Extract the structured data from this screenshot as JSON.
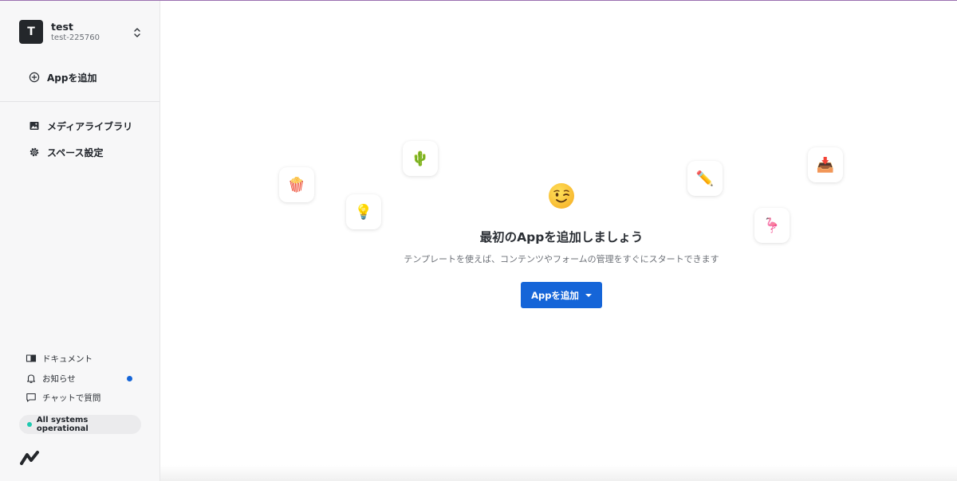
{
  "sidebar": {
    "space": {
      "avatar_letter": "T",
      "name": "test",
      "id": "test-225760"
    },
    "add_app_label": "Appを追加",
    "nav": [
      {
        "label": "メディアライブラリ",
        "icon": "image-icon"
      },
      {
        "label": "スペース設定",
        "icon": "gear-icon"
      }
    ],
    "utilities": [
      {
        "label": "ドキュメント",
        "icon": "book-icon"
      },
      {
        "label": "お知らせ",
        "icon": "bell-icon"
      },
      {
        "label": "チャットで質問",
        "icon": "chat-icon"
      }
    ],
    "status": {
      "label": "All systems operational",
      "color": "#1ec9b0"
    },
    "notify_dot_color": "#1565d8"
  },
  "main": {
    "heading": "最初のAppを追加しましょう",
    "subtext": "テンプレートを使えば、コンテンツやフォームの管理をすぐにスタートできます",
    "add_button_label": "Appを追加",
    "emojis": [
      {
        "name": "popcorn-icon",
        "glyph": "🍿"
      },
      {
        "name": "lightbulb-icon",
        "glyph": "💡"
      },
      {
        "name": "cactus-icon",
        "glyph": "🌵"
      },
      {
        "name": "pencil-icon",
        "glyph": "✏️"
      },
      {
        "name": "flamingo-icon",
        "glyph": "🦩"
      },
      {
        "name": "inbox-tray-icon",
        "glyph": "📥"
      }
    ],
    "accent_color": "#1565d8"
  }
}
